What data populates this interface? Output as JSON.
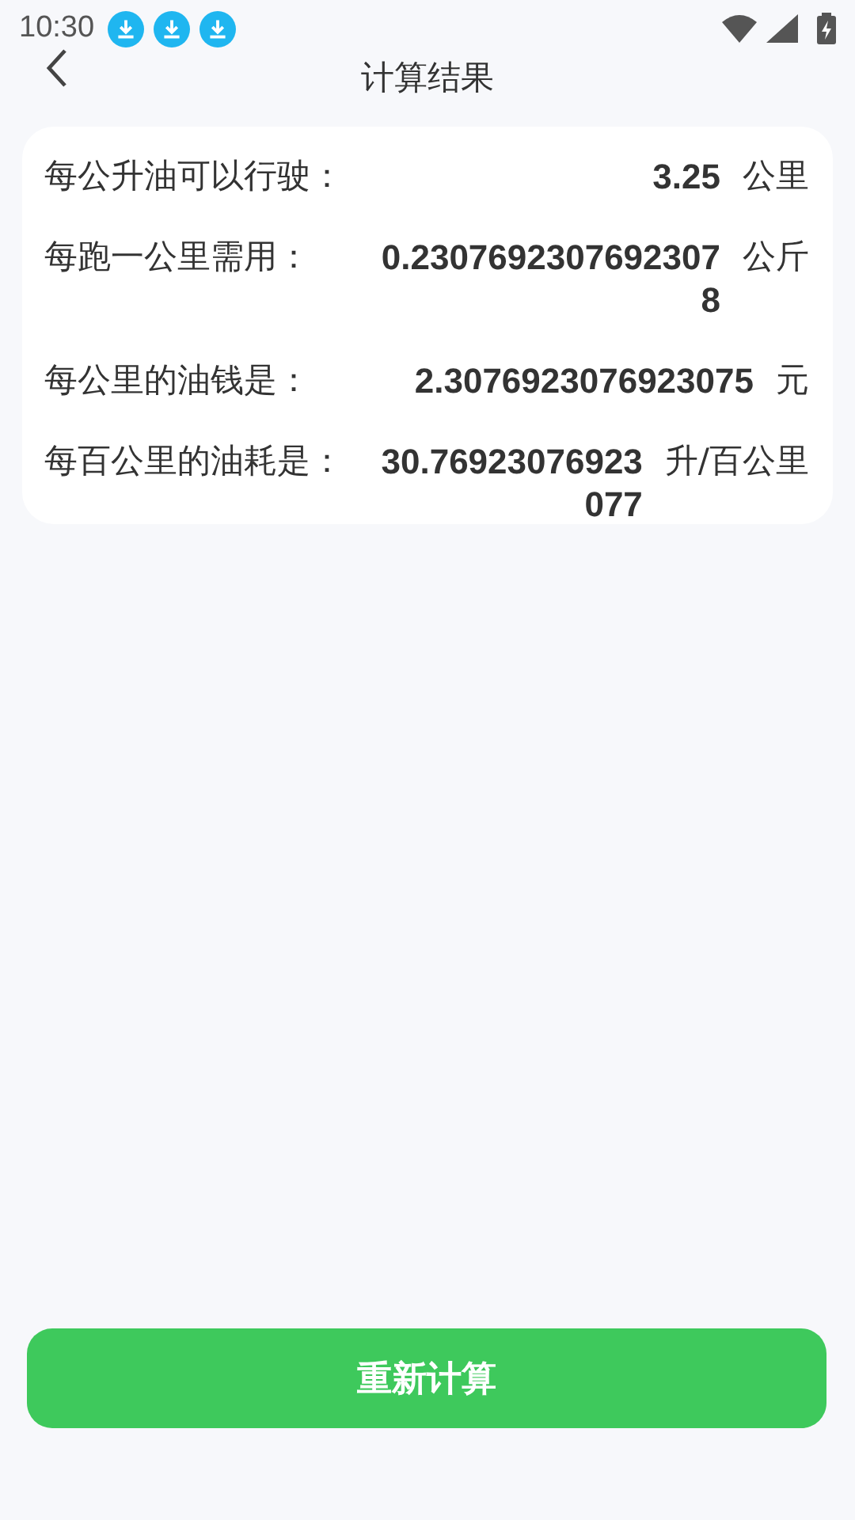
{
  "status_bar": {
    "time": "10:30",
    "notifications": [
      {
        "kind": "download"
      },
      {
        "kind": "download"
      },
      {
        "kind": "download"
      }
    ]
  },
  "header": {
    "title": "计算结果"
  },
  "results": [
    {
      "label": "每公升油可以行驶：",
      "value": "3.25",
      "unit": "公里"
    },
    {
      "label": "每跑一公里需用：",
      "value": "0.23076923076923078",
      "unit": "公斤"
    },
    {
      "label": "每公里的油钱是：",
      "value": "2.3076923076923075",
      "unit": "元"
    },
    {
      "label": "每百公里的油耗是：",
      "value": "30.76923076923077",
      "unit": "升/百公里"
    }
  ],
  "button": {
    "label": "重新计算"
  }
}
